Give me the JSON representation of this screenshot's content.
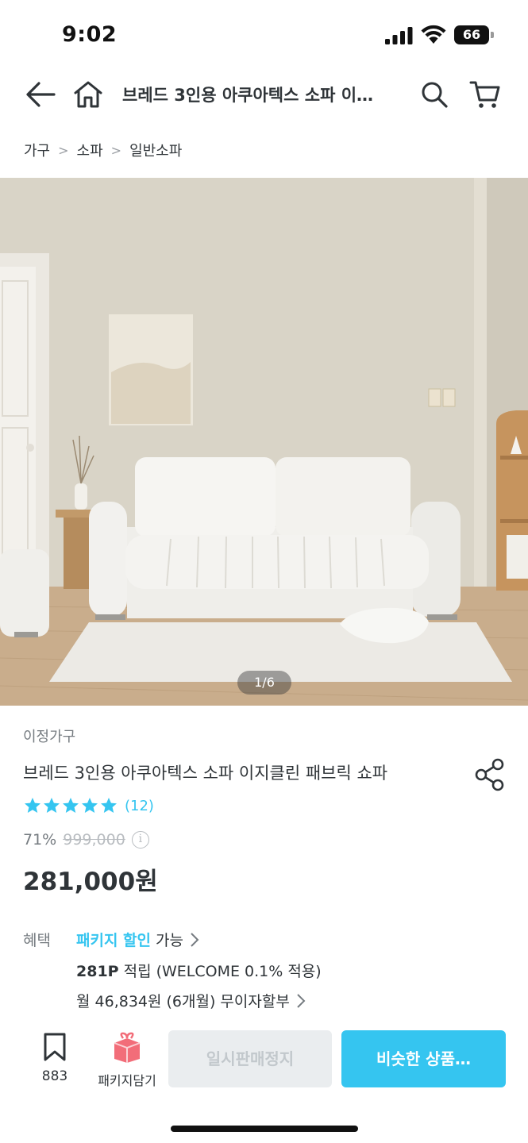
{
  "status_bar": {
    "time": "9:02",
    "battery": "66"
  },
  "header": {
    "title": "브레드 3인용 아쿠아텍스 소파 이…",
    "icons": [
      "back-arrow-icon",
      "home-icon",
      "search-icon",
      "cart-icon"
    ]
  },
  "breadcrumb": [
    "가구",
    "소파",
    "일반소파"
  ],
  "gallery": {
    "counter": "1/6"
  },
  "product": {
    "brand": "이정가구",
    "name": "브레드 3인용 아쿠아텍스 소파 이지클린 패브릭 쇼파",
    "rating_stars": 5,
    "review_count": "(12)",
    "discount": "71%",
    "original_price": "999,000",
    "price": "281,000원"
  },
  "benefits": {
    "label": "혜택",
    "package_highlight": "패키지 할인",
    "package_suffix": "가능",
    "points_bold": "281P",
    "points_text": "적립 (WELCOME 0.1% 적용)",
    "installment": "월 46,834원 (6개월) 무이자할부"
  },
  "bottom_bar": {
    "bookmark_count": "883",
    "package_label": "패키지담기",
    "soldout_label": "일시판매정지",
    "similar_label": "비슷한 상품…"
  },
  "colors": {
    "accent": "#35c5f0",
    "text": "#2f3438",
    "muted": "#757b80",
    "disabled_bg": "#eaedef"
  }
}
